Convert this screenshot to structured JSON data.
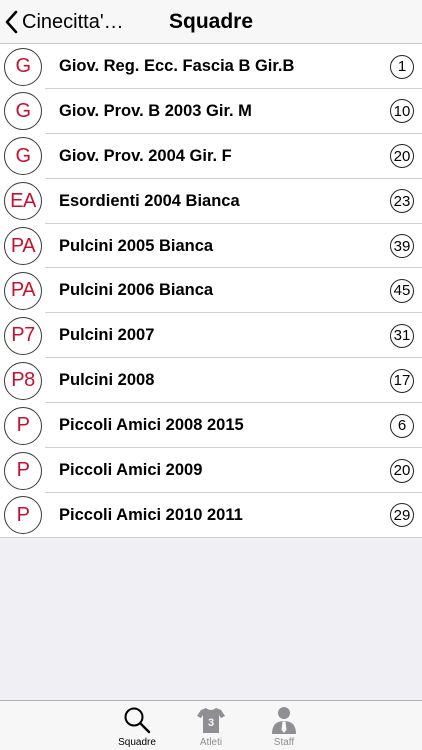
{
  "navbar": {
    "back_label": "Cinecitta'…",
    "title": "Squadre"
  },
  "colors": {
    "badge_text": "#c8102e",
    "tab_inactive": "#8e8e93"
  },
  "teams": [
    {
      "badge": "G",
      "name": "Giov. Reg. Ecc. Fascia B Gir.B",
      "count": "1"
    },
    {
      "badge": "G",
      "name": "Giov. Prov. B 2003 Gir. M",
      "count": "10"
    },
    {
      "badge": "G",
      "name": "Giov. Prov. 2004 Gir. F",
      "count": "20"
    },
    {
      "badge": "EA",
      "name": "Esordienti 2004 Bianca",
      "count": "23"
    },
    {
      "badge": "PA",
      "name": "Pulcini 2005 Bianca",
      "count": "39"
    },
    {
      "badge": "PA",
      "name": "Pulcini 2006 Bianca",
      "count": "45"
    },
    {
      "badge": "P7",
      "name": "Pulcini 2007",
      "count": "31"
    },
    {
      "badge": "P8",
      "name": "Pulcini 2008",
      "count": "17"
    },
    {
      "badge": "P",
      "name": "Piccoli Amici 2008 2015",
      "count": "6"
    },
    {
      "badge": "P",
      "name": "Piccoli Amici 2009",
      "count": "20"
    },
    {
      "badge": "P",
      "name": "Piccoli Amici 2010 2011",
      "count": "29"
    }
  ],
  "tabbar": {
    "tabs": [
      {
        "label": "Squadre",
        "icon": "search-icon",
        "active": true
      },
      {
        "label": "Atleti",
        "icon": "jersey-icon",
        "jersey_number": "3",
        "active": false
      },
      {
        "label": "Staff",
        "icon": "person-tie-icon",
        "active": false
      }
    ]
  }
}
